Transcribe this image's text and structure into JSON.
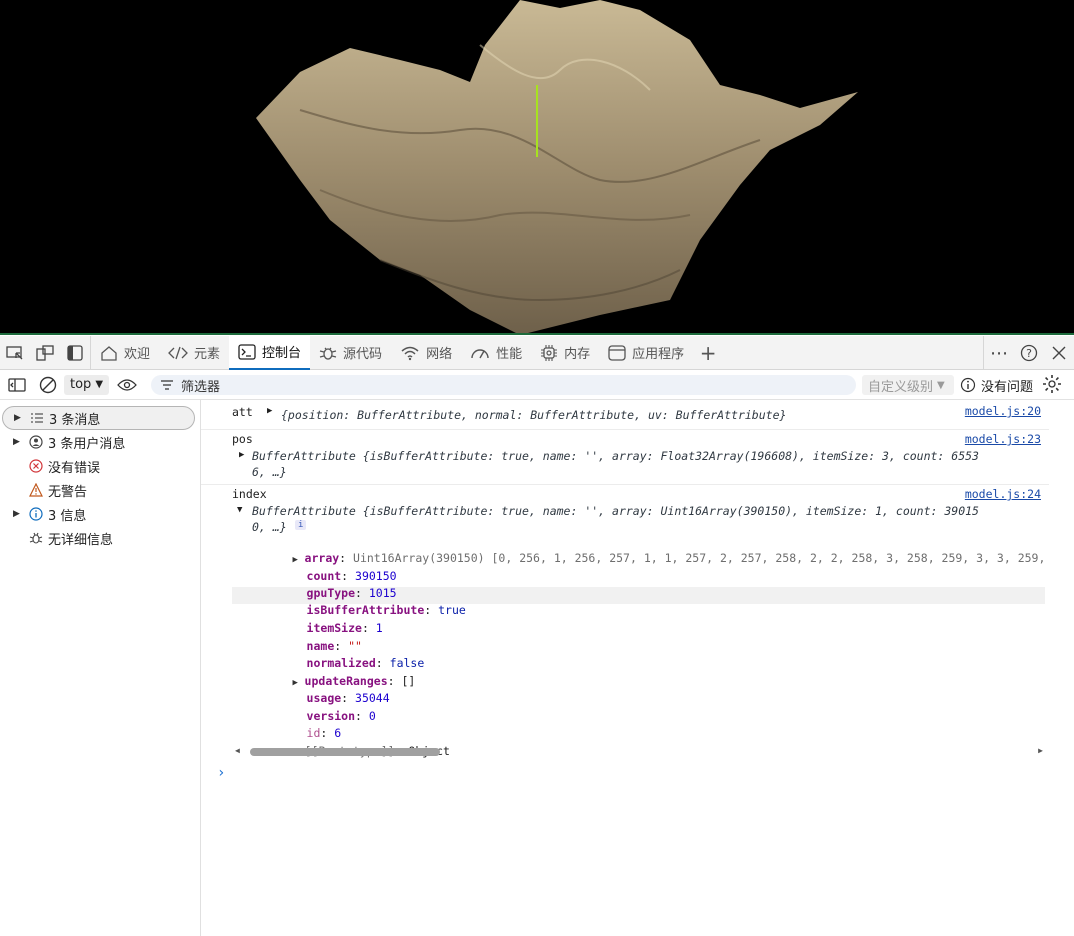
{
  "tabs": [
    {
      "label": "欢迎",
      "icon": "home-icon"
    },
    {
      "label": "元素",
      "icon": "code-icon"
    },
    {
      "label": "控制台",
      "icon": "console-icon"
    },
    {
      "label": "源代码",
      "icon": "bug-icon"
    },
    {
      "label": "网络",
      "icon": "wifi-icon"
    },
    {
      "label": "性能",
      "icon": "gauge-icon"
    },
    {
      "label": "内存",
      "icon": "chip-icon"
    },
    {
      "label": "应用程序",
      "icon": "window-icon"
    }
  ],
  "add_tab": "+",
  "toolbar": {
    "context": "top",
    "filter_placeholder": "筛选器",
    "levels": "自定义级别",
    "issues": "没有问题"
  },
  "sidebar": [
    {
      "label": "3 条消息",
      "icon": "list-icon",
      "expandable": true,
      "selected": true
    },
    {
      "label": "3 条用户消息",
      "icon": "user-icon",
      "expandable": true
    },
    {
      "label": "没有错误",
      "icon": "error-icon"
    },
    {
      "label": "无警告",
      "icon": "warning-icon"
    },
    {
      "label": "3 信息",
      "icon": "info-icon",
      "expandable": true
    },
    {
      "label": "无详细信息",
      "icon": "verbose-bug-icon"
    }
  ],
  "messages": {
    "m1": {
      "label": "att",
      "source": "model.js:20",
      "obj": "{position: BufferAttribute, normal: BufferAttribute, uv: BufferAttribute}"
    },
    "m2": {
      "label": "pos",
      "source": "model.js:23",
      "line1": "BufferAttribute {isBufferAttribute: true, name: '', array: Float32Array(196608), itemSize: 3, count: 6553",
      "line2": "6, …}"
    },
    "m3": {
      "label": "index",
      "source": "model.js:24",
      "line1": "BufferAttribute {isBufferAttribute: true, name: '', array: Uint16Array(390150), itemSize: 1, count: 39015",
      "line2": "0, …}",
      "info_badge": "i"
    }
  },
  "props": {
    "array": {
      "key": "array",
      "value": "Uint16Array(390150) [0, 256, 1, 256, 257, 1, 1, 257, 2, 257, 258, 2, 2, 258, 3, 258, 259, 3, 3, 259,"
    },
    "count": {
      "key": "count",
      "value": "390150"
    },
    "gpuType": {
      "key": "gpuType",
      "value": "1015"
    },
    "isBufferAttribute": {
      "key": "isBufferAttribute",
      "value": "true"
    },
    "itemSize": {
      "key": "itemSize",
      "value": "1"
    },
    "name": {
      "key": "name",
      "value": "\"\""
    },
    "normalized": {
      "key": "normalized",
      "value": "false"
    },
    "updateRanges": {
      "key": "updateRanges",
      "value": "[]"
    },
    "usage": {
      "key": "usage",
      "value": "35044"
    },
    "version": {
      "key": "version",
      "value": "0"
    },
    "id": {
      "key": "id",
      "value": "6"
    },
    "prototype": {
      "key": "[[Prototype]]",
      "value": "Object"
    }
  },
  "prompt_symbol": "›",
  "colors": {
    "accent": "#0f6cbd",
    "terrain": "#a8977a",
    "viewport_bg": "#000000"
  }
}
